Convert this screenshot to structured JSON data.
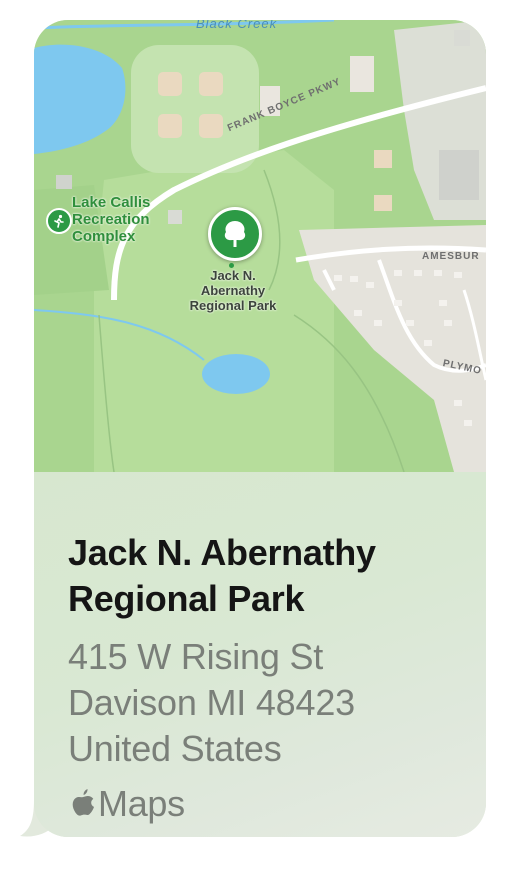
{
  "map": {
    "creek_label": "Black Creek",
    "road_frank_boyce": "FRANK BOYCE PKWY",
    "road_amesbury": "AMESBUR",
    "road_plymouth": "PLYMO",
    "poi_recreation": "Lake Callis\nRecreation\nComplex",
    "poi_park": "Jack N.\nAbernathy\nRegional Park",
    "park_icon": "tree-icon",
    "recreation_icon": "runner-icon",
    "colors": {
      "park_green": "#2c9a45",
      "water": "#7ec8ef",
      "land": "#a9d58f"
    }
  },
  "card": {
    "name": "Jack N. Abernathy Regional Park",
    "address_line1": "415 W Rising St",
    "address_line2": "Davison MI 48423",
    "address_line3": "United States",
    "brand": "Maps",
    "brand_icon": "apple-logo-icon"
  }
}
